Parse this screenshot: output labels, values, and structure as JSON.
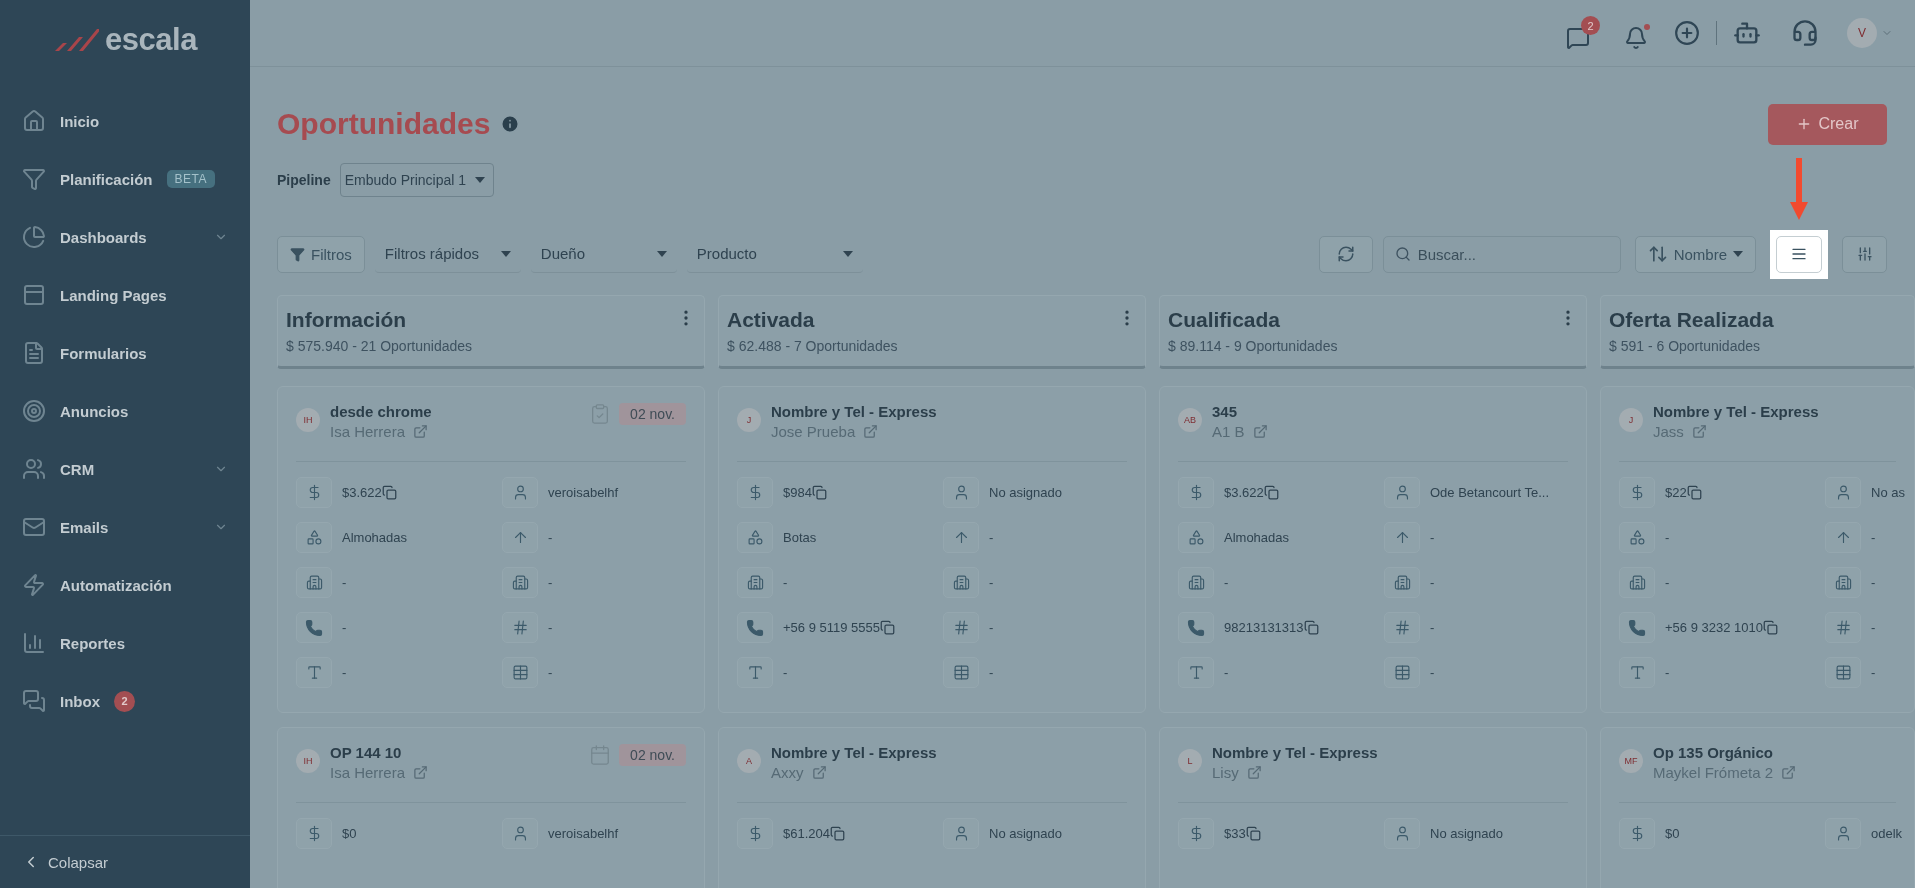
{
  "sidebar": {
    "logo": "escala",
    "items": [
      {
        "label": "Inicio",
        "expandable": false
      },
      {
        "label": "Planificación",
        "expandable": false,
        "tag": "BETA"
      },
      {
        "label": "Dashboards",
        "expandable": true
      },
      {
        "label": "Landing Pages",
        "expandable": false
      },
      {
        "label": "Formularios",
        "expandable": false
      },
      {
        "label": "Anuncios",
        "expandable": false
      },
      {
        "label": "CRM",
        "expandable": true
      },
      {
        "label": "Emails",
        "expandable": true
      },
      {
        "label": "Automatización",
        "expandable": false
      },
      {
        "label": "Reportes",
        "expandable": false
      },
      {
        "label": "Inbox",
        "expandable": false,
        "count": "2"
      }
    ],
    "collapse": "Colapsar"
  },
  "header": {
    "chat_count": "2",
    "avatar": "V"
  },
  "page": {
    "title": "Oportunidades",
    "create": "Crear",
    "pipeline_label": "Pipeline",
    "pipeline": "Embudo Principal 1"
  },
  "toolbar": {
    "filters": "Filtros",
    "quick_filters": "Filtros rápidos",
    "owner": "Dueño",
    "product": "Producto",
    "search_placeholder": "Buscar...",
    "sort": "Nombre",
    "list_view_highlighted": true
  },
  "columns": [
    {
      "name": "Información",
      "summary": "$ 575.940 - 21 Oportunidades",
      "menu": true,
      "cards": [
        {
          "initials": "IH",
          "title": "desde chrome",
          "owner": "Isa Herrera",
          "date": {
            "text": "02 nov.",
            "kind": "task"
          },
          "fields": [
            {
              "value": "$3.622",
              "copyable": true
            },
            {
              "value": "veroisabelhf",
              "copyable": false
            },
            {
              "value": "Almohadas",
              "copyable": false
            },
            {
              "value": "-",
              "copyable": false
            },
            {
              "value": "-",
              "copyable": false
            },
            {
              "value": "-",
              "copyable": false
            },
            {
              "value": "-",
              "copyable": false
            },
            {
              "value": "-",
              "copyable": false
            },
            {
              "value": "-",
              "copyable": false
            },
            {
              "value": "-",
              "copyable": false
            }
          ]
        },
        {
          "initials": "IH",
          "title": "OP 144 10",
          "owner": "Isa Herrera",
          "date": {
            "text": "02 nov.",
            "kind": "event"
          },
          "fields": [
            {
              "value": "$0",
              "copyable": false
            },
            {
              "value": "veroisabelhf",
              "copyable": false
            }
          ]
        }
      ]
    },
    {
      "name": "Activada",
      "summary": "$ 62.488 - 7 Oportunidades",
      "menu": true,
      "cards": [
        {
          "initials": "J",
          "title": "Nombre y Tel - Express",
          "owner": "Jose Prueba",
          "fields": [
            {
              "value": "$984",
              "copyable": true
            },
            {
              "value": "No asignado",
              "copyable": false
            },
            {
              "value": "Botas",
              "copyable": false
            },
            {
              "value": "-",
              "copyable": false
            },
            {
              "value": "-",
              "copyable": false
            },
            {
              "value": "-",
              "copyable": false
            },
            {
              "value": "+56 9 5119 5555",
              "copyable": true
            },
            {
              "value": "-",
              "copyable": false
            },
            {
              "value": "-",
              "copyable": false
            },
            {
              "value": "-",
              "copyable": false
            }
          ]
        },
        {
          "initials": "A",
          "title": "Nombre y Tel - Express",
          "owner": "Axxy",
          "fields": [
            {
              "value": "$61.204",
              "copyable": true
            },
            {
              "value": "No asignado",
              "copyable": false
            }
          ]
        }
      ]
    },
    {
      "name": "Cualificada",
      "summary": "$ 89.114 - 9 Oportunidades",
      "menu": true,
      "cards": [
        {
          "initials": "AB",
          "title": "345",
          "owner": "A1 B",
          "fields": [
            {
              "value": "$3.622",
              "copyable": true
            },
            {
              "value": "Ode Betancourt Te...",
              "copyable": false
            },
            {
              "value": "Almohadas",
              "copyable": false
            },
            {
              "value": "-",
              "copyable": false
            },
            {
              "value": "-",
              "copyable": false
            },
            {
              "value": "-",
              "copyable": false
            },
            {
              "value": "98213131313",
              "copyable": true
            },
            {
              "value": "-",
              "copyable": false
            },
            {
              "value": "-",
              "copyable": false
            },
            {
              "value": "-",
              "copyable": false
            }
          ]
        },
        {
          "initials": "L",
          "title": "Nombre y Tel - Express",
          "owner": "Lisy",
          "fields": [
            {
              "value": "$33",
              "copyable": true
            },
            {
              "value": "No asignado",
              "copyable": false
            }
          ]
        }
      ]
    },
    {
      "name": "Oferta Realizada",
      "summary": "$ 591 - 6 Oportunidades",
      "menu": false,
      "cards": [
        {
          "initials": "J",
          "title": "Nombre y Tel - Express",
          "owner": "Jass",
          "fields": [
            {
              "value": "$22",
              "copyable": true
            },
            {
              "value": "No as",
              "copyable": false
            },
            {
              "value": "-",
              "copyable": false
            },
            {
              "value": "-",
              "copyable": false
            },
            {
              "value": "-",
              "copyable": false
            },
            {
              "value": "-",
              "copyable": false
            },
            {
              "value": "+56 9 3232 1010",
              "copyable": true
            },
            {
              "value": "-",
              "copyable": false
            },
            {
              "value": "-",
              "copyable": false
            },
            {
              "value": "-",
              "copyable": false
            }
          ]
        },
        {
          "initials": "MF",
          "title": "Op 135 Orgánico",
          "owner": "Maykel Frómeta 2",
          "fields": [
            {
              "value": "$0",
              "copyable": false
            },
            {
              "value": "odelk",
              "copyable": false
            }
          ]
        }
      ]
    }
  ]
}
